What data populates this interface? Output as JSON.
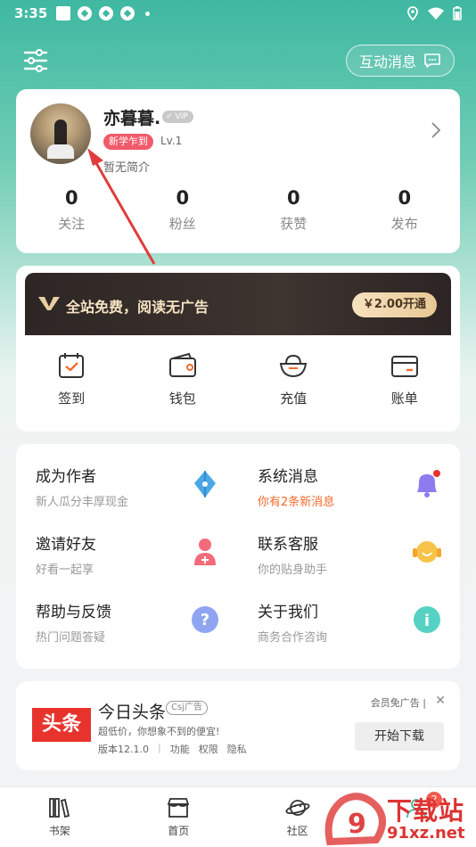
{
  "status_bar": {
    "time": "3:35"
  },
  "header": {
    "interact_label": "互动消息"
  },
  "profile": {
    "name": "亦暮暮.",
    "vip_badge": "VIP",
    "tag": "新学乍到",
    "level": "Lv.1",
    "intro": "暂无简介",
    "stats": [
      {
        "value": "0",
        "label": "关注"
      },
      {
        "value": "0",
        "label": "粉丝"
      },
      {
        "value": "0",
        "label": "获赞"
      },
      {
        "value": "0",
        "label": "发布"
      }
    ]
  },
  "vip": {
    "text": "全站免费，阅读无广告",
    "price_button": "￥2.00开通"
  },
  "quick_actions": [
    {
      "label": "签到",
      "icon": "calendar-check-icon"
    },
    {
      "label": "钱包",
      "icon": "wallet-icon"
    },
    {
      "label": "充值",
      "icon": "recharge-bowl-icon"
    },
    {
      "label": "账单",
      "icon": "bill-card-icon"
    }
  ],
  "menu": [
    {
      "title": "成为作者",
      "subtitle": "新人瓜分丰厚现金",
      "icon": "pen-nib-icon"
    },
    {
      "title": "系统消息",
      "subtitle": "你有2条新消息",
      "icon": "bell-icon",
      "alert": true
    },
    {
      "title": "邀请好友",
      "subtitle": "好看一起享",
      "icon": "add-friend-icon"
    },
    {
      "title": "联系客服",
      "subtitle": "你的贴身助手",
      "icon": "headset-icon"
    },
    {
      "title": "帮助与反馈",
      "subtitle": "热门问题答疑",
      "icon": "question-icon"
    },
    {
      "title": "关于我们",
      "subtitle": "商务合作咨询",
      "icon": "info-icon"
    }
  ],
  "ad": {
    "logo": "头条",
    "title": "今日头条",
    "tag": "Csj广告",
    "desc": "超低价，你想象不到的便宜!",
    "version": "版本12.1.0",
    "links": [
      "功能",
      "权限",
      "隐私"
    ],
    "free_ads": "会员免广告",
    "close": "✕",
    "download": "开始下载"
  },
  "nav": [
    {
      "label": "书架",
      "icon": "bookshelf-icon"
    },
    {
      "label": "首页",
      "icon": "store-icon"
    },
    {
      "label": "社区",
      "icon": "planet-icon"
    },
    {
      "label": "",
      "icon": "profile-icon"
    }
  ],
  "nav_badge": "2",
  "watermark": {
    "main": "下载站",
    "sub": "91xz.net"
  },
  "colors": {
    "accent": "#3fb8a2",
    "alert": "#f26b2b",
    "badge": "#f15a6a",
    "vip_gold": "#e8c895"
  }
}
